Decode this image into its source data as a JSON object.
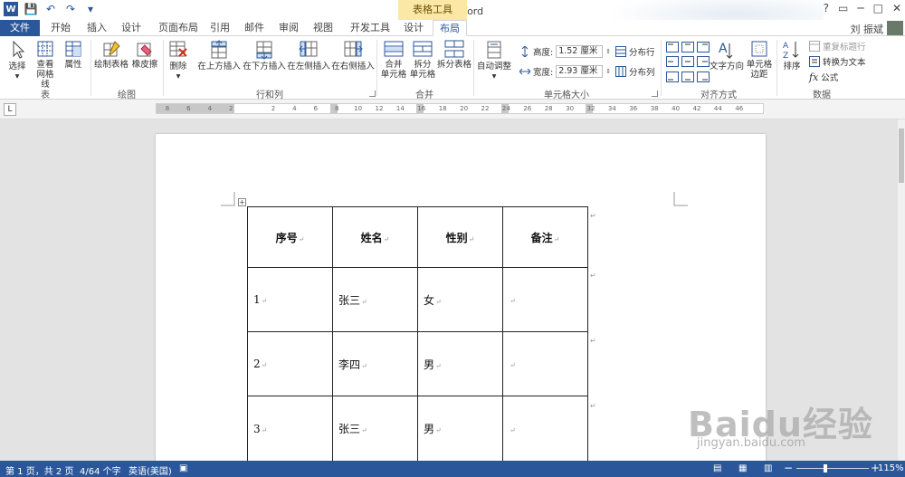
{
  "window": {
    "title": "文档1 - Word",
    "context_header": "表格工具",
    "help": "?",
    "ribbon_display": "▭",
    "minimize": "─",
    "maximize": "□",
    "close": "✕"
  },
  "quick_access": {
    "logo": "W",
    "save": "💾",
    "undo": "↶",
    "redo": "↷",
    "customize": "▾"
  },
  "tabs": [
    "文件",
    "开始",
    "插入",
    "设计",
    "页面布局",
    "引用",
    "邮件",
    "审阅",
    "视图",
    "开发工具",
    "设计",
    "布局"
  ],
  "user": {
    "name": "刘 振斌"
  },
  "ribbon": {
    "groups": {
      "table": "表",
      "draw": "绘图",
      "rows_cols": "行和列",
      "merge": "合并",
      "cell_size": "单元格大小",
      "align": "对齐方式",
      "data": "数据"
    },
    "buttons": {
      "select": "选择",
      "select_arrow": "▾",
      "view_gridlines_1": "查看",
      "view_gridlines_2": "网格线",
      "properties": "属性",
      "draw_table": "绘制表格",
      "eraser": "橡皮擦",
      "delete": "删除",
      "delete_arrow": "▾",
      "insert_above": "在上方插入",
      "insert_below": "在下方插入",
      "insert_left": "在左侧插入",
      "insert_right": "在右侧插入",
      "merge_cells_1": "合并",
      "merge_cells_2": "单元格",
      "split_cells_1": "拆分",
      "split_cells_2": "单元格",
      "split_table": "拆分表格",
      "autofit": "自动调整",
      "autofit_arrow": "▾",
      "height_label": "高度:",
      "height_value": "1.52 厘米",
      "width_label": "宽度:",
      "width_value": "2.93 厘米",
      "distribute_rows": "分布行",
      "distribute_cols": "分布列",
      "text_direction": "文字方向",
      "cell_margins_1": "单元格",
      "cell_margins_2": "边距",
      "sort": "排序",
      "repeat_header": "重复标题行",
      "convert_text": "转换为文本",
      "formula": "公式"
    }
  },
  "ruler": {
    "corner": "L",
    "ticks": [
      "8",
      "6",
      "4",
      "2",
      "",
      "2",
      "4",
      "6",
      "8",
      "10",
      "12",
      "14",
      "16",
      "18",
      "20",
      "22",
      "24",
      "26",
      "28",
      "30",
      "32",
      "34",
      "36",
      "38",
      "40",
      "42",
      "44",
      "46"
    ]
  },
  "document": {
    "move_handle": "+",
    "table": {
      "header": [
        "序号",
        "姓名",
        "性别",
        "备注"
      ],
      "rows": [
        [
          "1",
          "张三",
          "女",
          ""
        ],
        [
          "2",
          "李四",
          "男",
          ""
        ],
        [
          "3",
          "张三",
          "男",
          ""
        ]
      ]
    },
    "mark": "↵"
  },
  "watermark": {
    "text": "Baidu经验",
    "url": "jingyan.baidu.com"
  },
  "status": {
    "page": "第 1 页，共 2 页",
    "words": "4/64 个字",
    "language": "英语(美国)",
    "zoom": "115%",
    "zoom_minus": "−",
    "zoom_plus": "+"
  },
  "colors": {
    "accent": "#2b579a",
    "context": "#fbe8a6"
  }
}
